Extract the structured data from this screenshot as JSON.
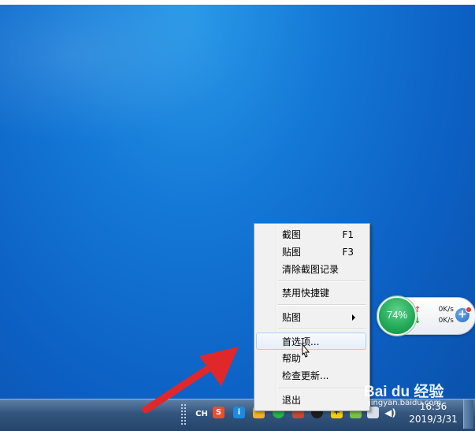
{
  "context_menu": {
    "items": [
      {
        "label": "截图",
        "shortcut": "F1"
      },
      {
        "label": "贴图",
        "shortcut": "F3"
      },
      {
        "label": "清除截图记录"
      },
      {
        "label": "禁用快捷键"
      },
      {
        "label": "贴图",
        "has_submenu": true
      },
      {
        "label": "首选项..."
      },
      {
        "label": "帮助"
      },
      {
        "label": "检查更新..."
      },
      {
        "label": "退出"
      }
    ]
  },
  "net_widget": {
    "memory_percent": "74%",
    "upload_speed": "0K/s",
    "download_speed": "0K/s",
    "upload_arrow": "↑",
    "download_arrow": "↓"
  },
  "taskbar": {
    "input_language": "CH",
    "clock_time": "16:36",
    "clock_date": "2019/3/31"
  },
  "watermark": {
    "brand": "Bai du 经验",
    "url": "jingyan.baidu.com"
  },
  "colors": {
    "desktop_blue": "#1478d6",
    "arrow_red": "#e0282a",
    "menu_bg": "#f1f1f1",
    "widget_green": "#21a956"
  }
}
